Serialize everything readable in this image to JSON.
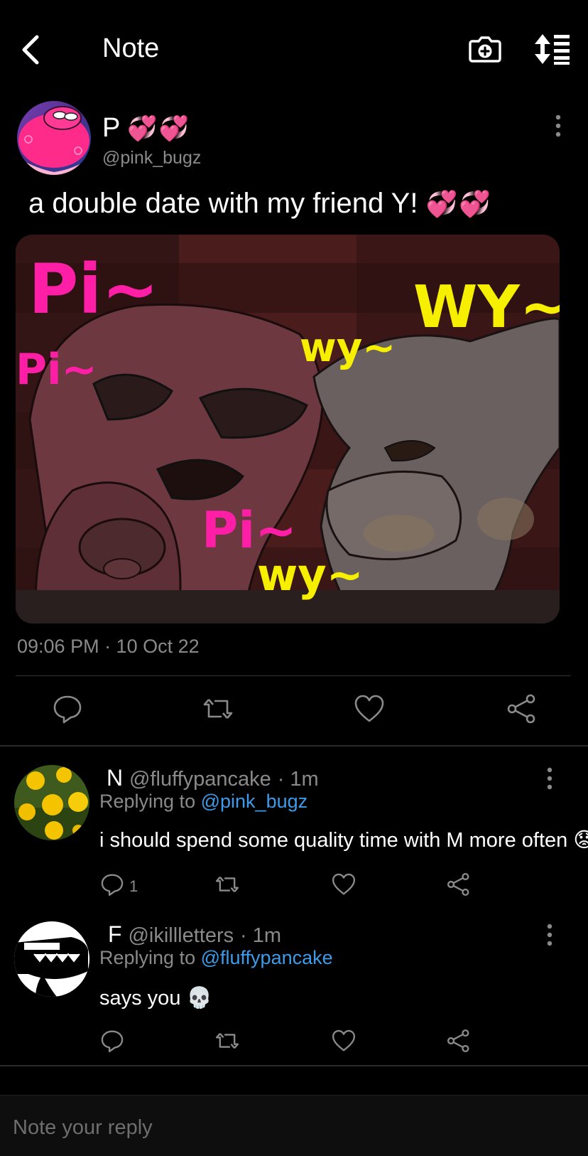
{
  "header": {
    "title": "Note",
    "back_icon": "chevron-left-icon",
    "camera_icon": "camera-plus-icon",
    "sort_icon": "sort-list-icon"
  },
  "note": {
    "author_name": "P",
    "author_emojis": "💞💞",
    "author_handle": "@pink_bugz",
    "text": "a double date with my friend Y!",
    "text_emojis": "💞💞",
    "timestamp": "09:06 PM · 10 Oct 22",
    "media_captions": {
      "pi_1": "Pi~",
      "pi_2": "Pi~",
      "pi_3": "Pi~",
      "wy_1": "wy~",
      "wy_2": "WY~",
      "wy_3": "wy~"
    }
  },
  "actions": [
    "reply-icon",
    "renote-icon",
    "heart-icon",
    "share-icon"
  ],
  "replies": [
    {
      "name": "N",
      "handle": "@fluffypancake",
      "time": "· 1m",
      "replying_label": "Replying to",
      "replying_to": "@pink_bugz",
      "body": "i should spend some quality time with M more often",
      "body_emoji": "😟",
      "reply_count": "1"
    },
    {
      "name": "F",
      "handle": "@ikillletters",
      "time": "· 1m",
      "replying_label": "Replying to",
      "replying_to": "@fluffypancake",
      "body": "says you",
      "body_emoji": "💀"
    }
  ],
  "composer": {
    "placeholder": "Note your reply"
  },
  "colors": {
    "background": "#000000",
    "mention": "#3d9be9",
    "muted": "#8a8a8a",
    "pink_caption": "#ff1fa6",
    "yellow_caption": "#f6f000"
  }
}
